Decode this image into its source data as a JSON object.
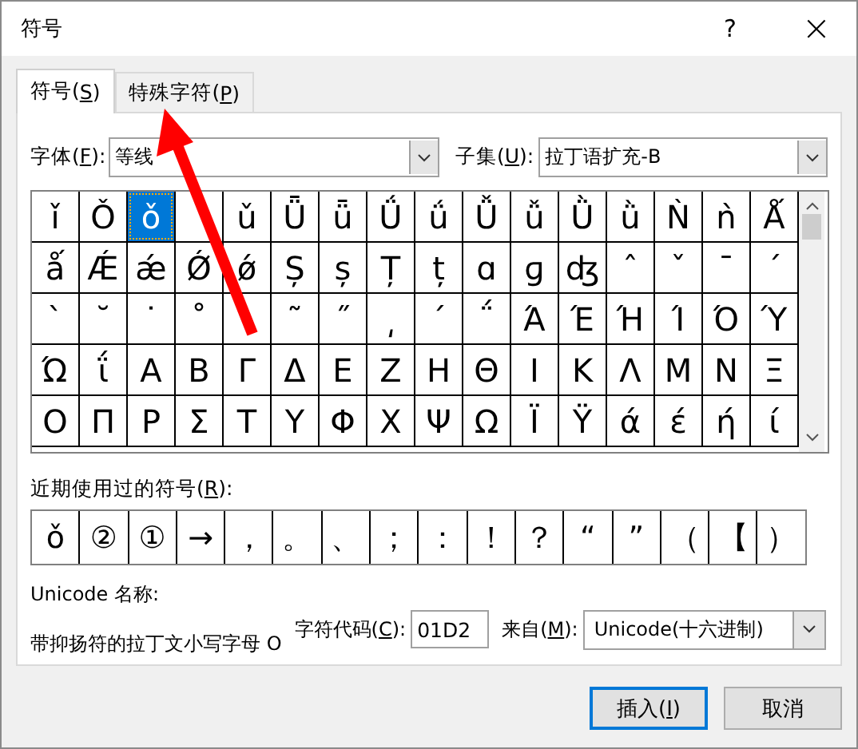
{
  "window": {
    "title": "符号",
    "help": "?",
    "close": "×"
  },
  "tabs": [
    {
      "label": "符号(S)",
      "selected": true
    },
    {
      "label": "特殊字符(P)",
      "selected": false
    }
  ],
  "font": {
    "label": "字体(F):",
    "value": "等线"
  },
  "subset": {
    "label": "子集(U):",
    "value": "拉丁语扩充-B"
  },
  "grid": {
    "selected": [
      false,
      false,
      true,
      false,
      false,
      false,
      false,
      false,
      false,
      false,
      false,
      false,
      false,
      false,
      false,
      false
    ],
    "rows": [
      [
        "ǐ",
        "Ǒ",
        "ǒ",
        null,
        "ǔ",
        "Ǖ",
        "ǖ",
        "Ǘ",
        "ǘ",
        "Ǚ",
        "ǚ",
        "Ǜ",
        "ǜ",
        "Ǹ",
        "ǹ",
        "Ǻ"
      ],
      [
        "ǻ",
        "Ǽ",
        "ǽ",
        "Ǿ",
        "ǿ",
        "Ș",
        "ș",
        "Ț",
        "ț",
        "ɑ",
        "ɡ",
        "ʤ",
        "ˆ",
        "ˇ",
        "ˉ",
        "ˊ"
      ],
      [
        "ˋ",
        "˘",
        "˙",
        "˚",
        null,
        "˜",
        "˝",
        "͵",
        "΄",
        "΅",
        "Ά",
        "Έ",
        "Ή",
        "Ί",
        "Ό",
        "Ύ"
      ],
      [
        "Ώ",
        "ΐ",
        "Α",
        "Β",
        "Γ",
        "Δ",
        "Ε",
        "Ζ",
        "Η",
        "Θ",
        "Ι",
        "Κ",
        "Λ",
        "Μ",
        "Ν",
        "Ξ"
      ],
      [
        "Ο",
        "Π",
        "Ρ",
        "Σ",
        "Τ",
        "Υ",
        "Φ",
        "Χ",
        "Ψ",
        "Ω",
        "Ϊ",
        "Ϋ",
        "ά",
        "έ",
        "ή",
        "ί"
      ]
    ]
  },
  "recent": {
    "label": "近期使用过的符号(R):",
    "symbols": [
      "ǒ",
      "②",
      "①",
      "→",
      "，",
      "。",
      "、",
      "；",
      "：",
      "！",
      "？",
      "“",
      "”",
      "（",
      "【",
      "）"
    ]
  },
  "unicode_name": {
    "label": "Unicode 名称:",
    "value": "带抑扬符的拉丁文小写字母 O"
  },
  "char_code": {
    "label": "字符代码(C):",
    "value": "01D2"
  },
  "from": {
    "label": "来自(M):",
    "value": "Unicode(十六进制)"
  },
  "buttons": [
    {
      "label": "插入(I)",
      "default": true
    },
    {
      "label": "取消",
      "default": false
    }
  ],
  "annotation": {
    "kind": "arrow"
  }
}
